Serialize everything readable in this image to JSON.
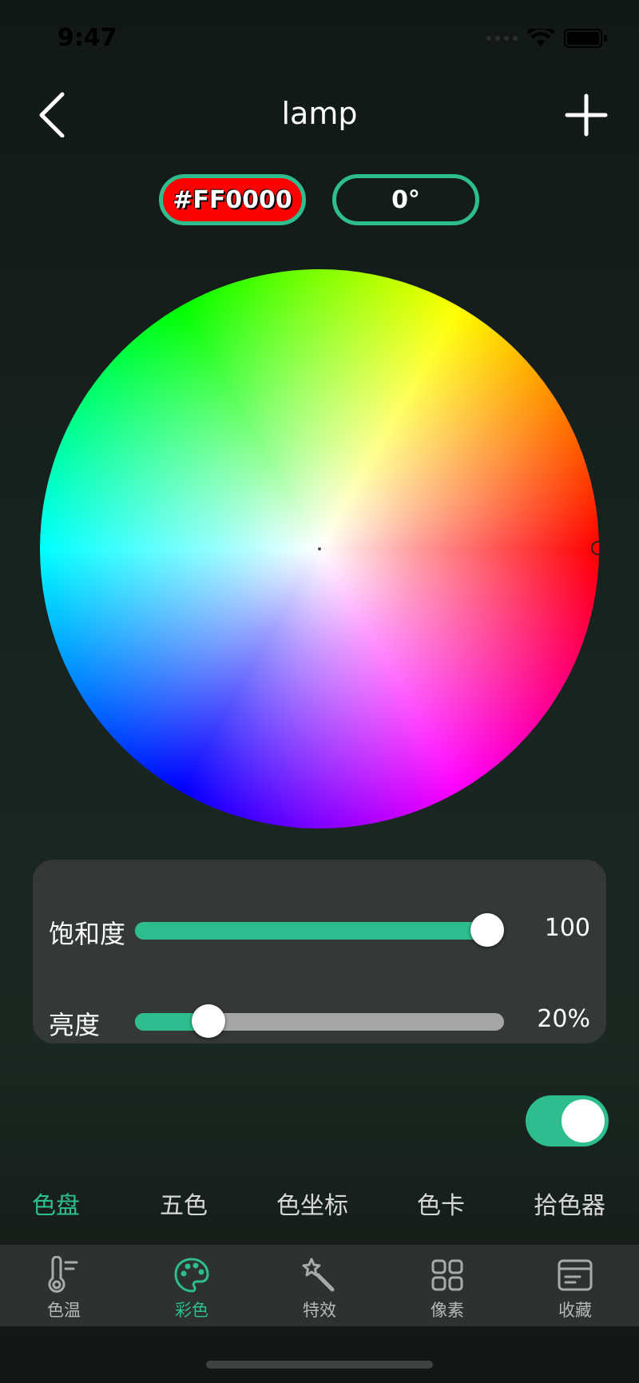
{
  "status_bar": {
    "time": "9:47"
  },
  "nav": {
    "title": "lamp"
  },
  "color": {
    "hex": "#FF0000",
    "hue": "0°",
    "accent": "#2dbd8e"
  },
  "sliders": {
    "saturation": {
      "label": "饱和度",
      "value": "100",
      "fraction": 1.0
    },
    "brightness": {
      "label": "亮度",
      "value": "20%",
      "fraction": 0.2
    }
  },
  "power_toggle": {
    "on": true
  },
  "mode_tabs": [
    {
      "label": "色盘",
      "active": true
    },
    {
      "label": "五色",
      "active": false
    },
    {
      "label": "色坐标",
      "active": false
    },
    {
      "label": "色卡",
      "active": false
    },
    {
      "label": "拾色器",
      "active": false
    }
  ],
  "tabbar": [
    {
      "label": "色温",
      "icon": "thermometer-icon",
      "active": false
    },
    {
      "label": "彩色",
      "icon": "palette-icon",
      "active": true
    },
    {
      "label": "特效",
      "icon": "magic-wand-icon",
      "active": false
    },
    {
      "label": "像素",
      "icon": "grid-icon",
      "active": false
    },
    {
      "label": "收藏",
      "icon": "card-icon",
      "active": false
    }
  ]
}
